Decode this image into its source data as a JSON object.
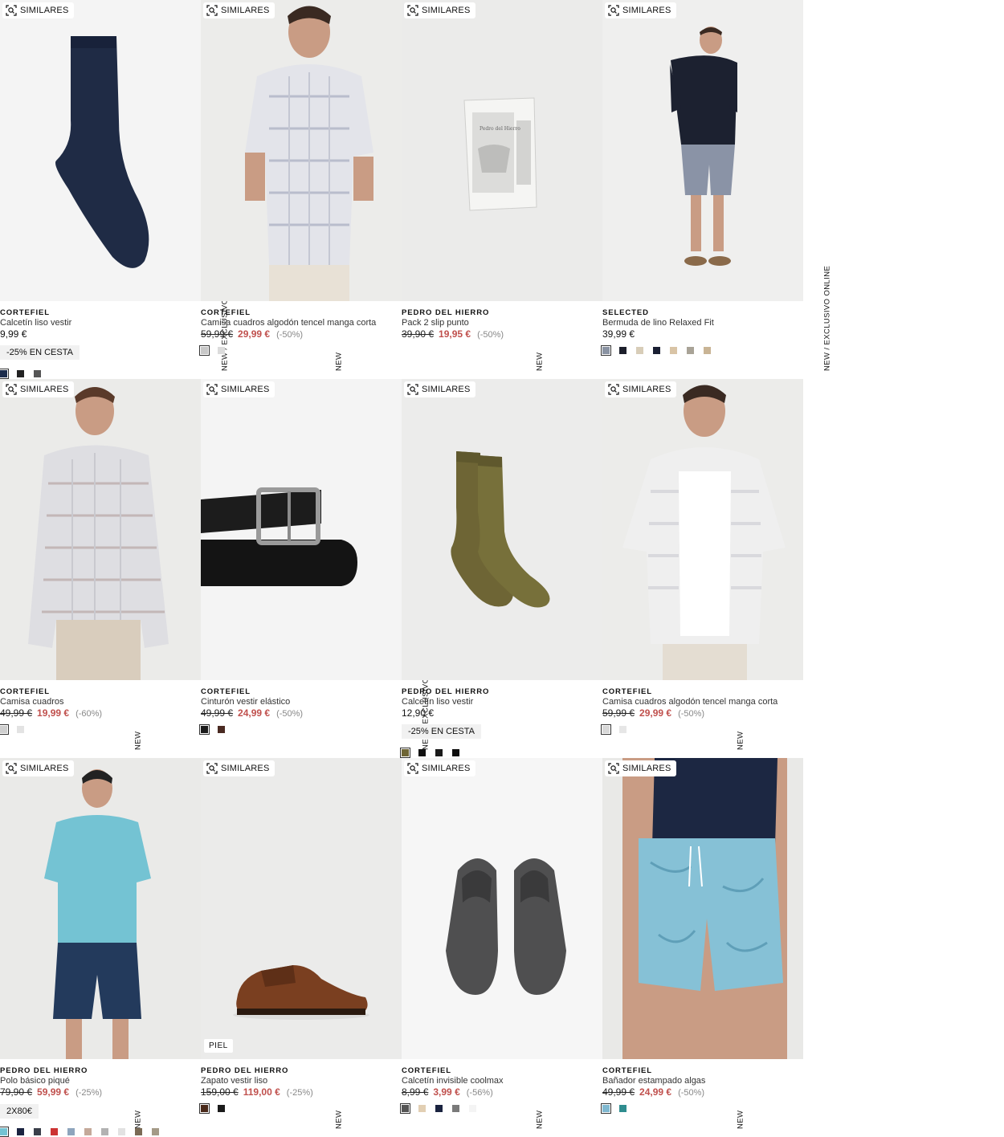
{
  "similares_label": "SIMILARES",
  "products": [
    {
      "brand": "CORTEFIEL",
      "name": "Calcetín liso vestir",
      "old": "",
      "price": "9,99 €",
      "discount": "",
      "promo": "-25% EN CESTA",
      "tag": "NEW  /  EXCLUSIVO ONLINE",
      "badge": "",
      "swatches": [
        "#1c2c4c",
        "#222222",
        "#555555"
      ],
      "image": "navy-sock"
    },
    {
      "brand": "CORTEFIEL",
      "name": "Camisa cuadros algodón tencel manga corta",
      "old": "59,99 €",
      "price": "29,99 €",
      "discount": "(-50%)",
      "promo": "",
      "tag": "NEW",
      "badge": "",
      "swatches": [
        "#c8c8c8",
        "#dcdcdc"
      ],
      "image": "man-shirt"
    },
    {
      "brand": "PEDRO DEL HIERRO",
      "name": "Pack 2 slip punto",
      "old": "39,90 €",
      "price": "19,95 €",
      "discount": "(-50%)",
      "promo": "",
      "tag": "NEW",
      "badge": "",
      "swatches": [],
      "image": "slip-box"
    },
    {
      "brand": "SELECTED",
      "name": "Bermuda de lino Relaxed Fit",
      "old": "",
      "price": "39,99 €",
      "discount": "",
      "promo": "",
      "tag": "NEW  /  EXCLUSIVO ONLINE",
      "badge": "",
      "swatches": [
        "#8a93a3",
        "#1c1f2b",
        "#d8cdb8",
        "#1a1f33",
        "#d9c4a6",
        "#a9a397",
        "#c9b495"
      ],
      "image": "man-shorts"
    },
    {
      "brand": "CORTEFIEL",
      "name": "Camisa cuadros",
      "old": "49,99 €",
      "price": "19,99 €",
      "discount": "(-60%)",
      "promo": "",
      "tag": "NEW",
      "badge": "",
      "swatches": [
        "#cfcfcf",
        "#e3e3e3"
      ],
      "image": "man-longshirt"
    },
    {
      "brand": "CORTEFIEL",
      "name": "Cinturón vestir elástico",
      "old": "49,99 €",
      "price": "24,99 €",
      "discount": "(-50%)",
      "promo": "",
      "tag": "NEW  /  EXCLUSIVO ONLINE",
      "badge": "",
      "swatches": [
        "#1b1b1b",
        "#4a2a22"
      ],
      "image": "belt"
    },
    {
      "brand": "PEDRO DEL HIERRO",
      "name": "Calcetín liso vestir",
      "old": "",
      "price": "12,90 €",
      "discount": "",
      "promo": "-25% EN CESTA",
      "tag": "",
      "badge": "",
      "swatches": [
        "#6e6535",
        "#111111",
        "#1a1a1a",
        "#0d0d0d"
      ],
      "image": "olive-sock"
    },
    {
      "brand": "CORTEFIEL",
      "name": "Camisa cuadros algodón tencel manga corta",
      "old": "59,99 €",
      "price": "29,99 €",
      "discount": "(-50%)",
      "promo": "",
      "tag": "NEW",
      "badge": "",
      "swatches": [
        "#d8d8d8",
        "#e6e6e6"
      ],
      "image": "man-whiteshirt"
    },
    {
      "brand": "PEDRO DEL HIERRO",
      "name": "Polo básico piqué",
      "old": "79,90 €",
      "price": "59,99 €",
      "discount": "(-25%)",
      "promo": "2X80€",
      "tag": "NEW",
      "badge": "",
      "swatches": [
        "#74c3d3",
        "#1a2340",
        "#3a3f4a",
        "#cc3333",
        "#8ea5bd",
        "#c4a99a",
        "#b2b2b2",
        "#e2e2e2",
        "#7a6a55",
        "#a49a87"
      ],
      "image": "man-polo"
    },
    {
      "brand": "PEDRO DEL HIERRO",
      "name": "Zapato vestir liso",
      "old": "159,00 €",
      "price": "119,00 €",
      "discount": "(-25%)",
      "promo": "",
      "tag": "NEW",
      "badge": "PIEL",
      "swatches": [
        "#4a2a1a",
        "#1b1b1b"
      ],
      "image": "shoe"
    },
    {
      "brand": "CORTEFIEL",
      "name": "Calcetín invisible coolmax",
      "old": "8,99 €",
      "price": "3,99 €",
      "discount": "(-56%)",
      "promo": "",
      "tag": "NEW",
      "badge": "",
      "swatches": [
        "#555555",
        "#e2cfb3",
        "#1a2340",
        "#7a7a7a",
        "#f4f4f4"
      ],
      "image": "invisible-sock"
    },
    {
      "brand": "CORTEFIEL",
      "name": "Bañador estampado algas",
      "old": "49,99 €",
      "price": "24,99 €",
      "discount": "(-50%)",
      "promo": "",
      "tag": "NEW",
      "badge": "",
      "swatches": [
        "#7fb8d0",
        "#2f8d8f"
      ],
      "image": "swim-shorts"
    }
  ]
}
